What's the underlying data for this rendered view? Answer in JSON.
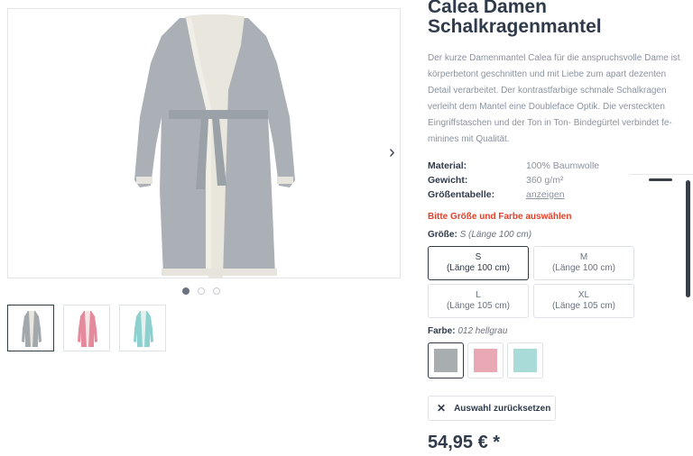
{
  "product": {
    "title_line1": "Calea Damen",
    "title_line2": "Schalkragenmantel",
    "description": "Der kurze Damenmantel Calea für die anspruchsvolle Dame ist körperbetont geschnitten und mit Liebe zum apart dezenten Detail verarbeitet. Der kontrastfarbige schmale Schalkragen verleiht dem Mantel eine Doubleface Optik. Die versteckten Eingriffstaschen und der Ton in Ton- Bindegürtel verbindet fe-minines mit Qualität.",
    "properties": [
      {
        "label": "Material:",
        "value": "100% Baumwolle"
      },
      {
        "label": "Gewicht:",
        "value": "360 g/m²"
      },
      {
        "label": "Größentabelle:",
        "value": "anzeigen"
      }
    ],
    "warning": "Bitte Größe und Farbe auswählen",
    "size_label": "Größe:",
    "size_selected": "S (Länge 100 cm)",
    "sizes": [
      {
        "name": "S",
        "detail": "(Länge 100 cm)",
        "active": true
      },
      {
        "name": "M",
        "detail": "(Länge 100 cm)",
        "active": false
      },
      {
        "name": "L",
        "detail": "(Länge 105 cm)",
        "active": false
      },
      {
        "name": "XL",
        "detail": "(Länge 105 cm)",
        "active": false
      }
    ],
    "color_label": "Farbe:",
    "color_selected": "012 hellgrau",
    "colors": [
      "#a8adb0",
      "#e9a9b4",
      "#a9dcd8"
    ],
    "reset_label": "Auswahl zurücksetzen",
    "price": "54,95 € *"
  },
  "gallery": {
    "next_icon": "chevron-right-icon",
    "dot_count": 3,
    "active_dot": 0,
    "thumb_colors": [
      "#a3a8ac",
      "#e58a9d",
      "#8cd1cf"
    ]
  }
}
